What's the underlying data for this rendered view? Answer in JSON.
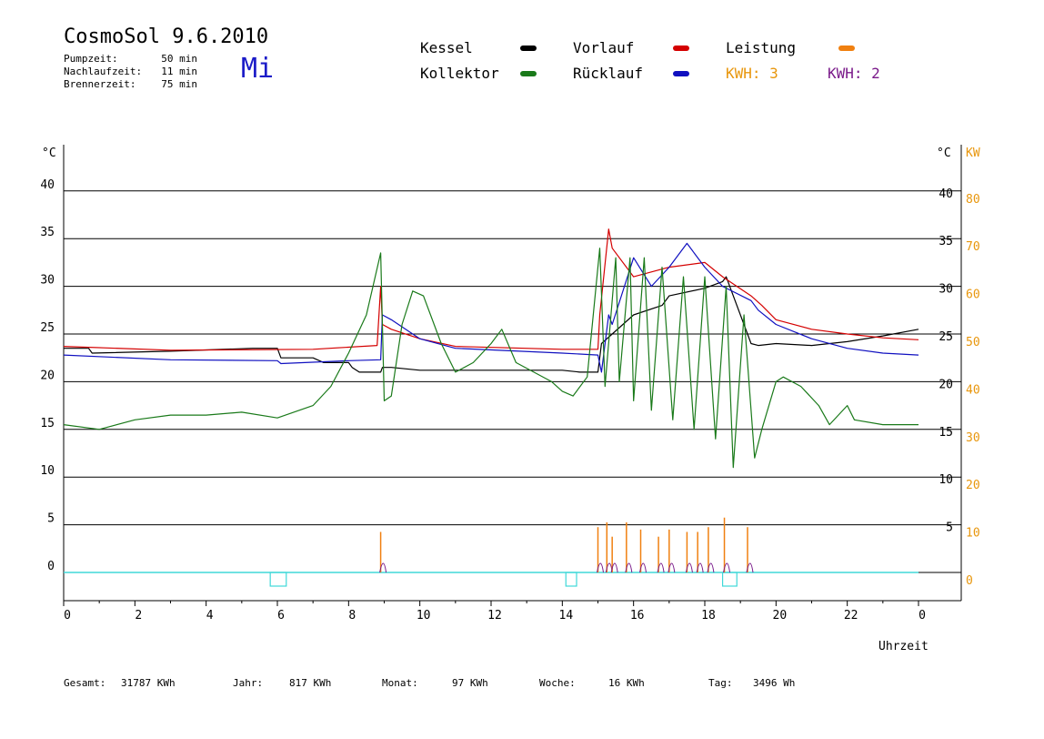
{
  "header": {
    "title": "CosmoSol 9.6.2010",
    "day": "Mi",
    "stats": [
      {
        "label": "Pumpzeit:",
        "value": "50 min"
      },
      {
        "label": "Nachlaufzeit:",
        "value": "11 min"
      },
      {
        "label": "Brennerzeit:",
        "value": "75 min"
      }
    ]
  },
  "legend": {
    "kessel": "Kessel",
    "vorlauf": "Vorlauf",
    "leistung": "Leistung",
    "kollektor": "Kollektor",
    "ruecklauf": "Rücklauf",
    "kwh1": "KWH: 3",
    "kwh2": "KWH: 2"
  },
  "footer": [
    {
      "label": "Gesamt:",
      "value": "31787 KWh"
    },
    {
      "label": "Jahr:",
      "value": "817 KWh"
    },
    {
      "label": "Monat:",
      "value": "97 KWh"
    },
    {
      "label": "Woche:",
      "value": "16 KWh"
    },
    {
      "label": "Tag:",
      "value": "3496 Wh"
    }
  ],
  "colors": {
    "kessel": "#000000",
    "vorlauf": "#d40000",
    "leistung": "#f08010",
    "kollektor": "#1a7a1a",
    "ruecklauf": "#1010c0",
    "kwh2": "#7a1a8a",
    "pump": "#40d8d8",
    "axis_kw": "#e8960c"
  },
  "chart_data": {
    "type": "line",
    "xlabel": "Uhrzeit",
    "x_ticks": [
      "0",
      "2",
      "4",
      "6",
      "8",
      "10",
      "12",
      "14",
      "16",
      "18",
      "20",
      "22",
      "0"
    ],
    "xlim": [
      0,
      24
    ],
    "y_left_label": "°C",
    "y_left_ticks": [
      "0",
      "5",
      "10",
      "15",
      "20",
      "25",
      "30",
      "35",
      "40"
    ],
    "y_right_label": "°C",
    "y_right_ticks": [
      "5",
      "10",
      "15",
      "20",
      "25",
      "30",
      "35",
      "40"
    ],
    "y_kw_label": "KW",
    "y_kw_ticks": [
      "0",
      "10",
      "20",
      "30",
      "40",
      "50",
      "60",
      "70",
      "80"
    ],
    "ylim": [
      0,
      40
    ],
    "grid": true,
    "series": [
      {
        "name": "Kessel",
        "color": "#000000",
        "x": [
          0,
          0.7,
          0.8,
          3,
          5.3,
          6,
          6.1,
          7,
          7.3,
          8,
          8.1,
          8.3,
          8.9,
          8.95,
          9.2,
          10,
          11.5,
          14,
          14.5,
          15,
          15.1,
          15.4,
          16,
          16.8,
          17,
          18,
          18.5,
          18.6,
          19.3,
          19.5,
          20,
          21,
          22,
          23,
          24
        ],
        "y": [
          23.5,
          23.5,
          23.0,
          23.2,
          23.5,
          23.5,
          22.5,
          22.5,
          22.0,
          22.0,
          21.5,
          21.0,
          21.0,
          21.5,
          21.5,
          21.2,
          21.2,
          21.2,
          21.0,
          21.0,
          24,
          25,
          27,
          28,
          29,
          29.8,
          30.5,
          31,
          24,
          23.8,
          24,
          23.8,
          24.2,
          24.8,
          25.5
        ]
      },
      {
        "name": "Vorlauf",
        "color": "#d40000",
        "x": [
          0,
          3,
          7,
          8.8,
          8.9,
          8.95,
          9.2,
          10,
          11,
          14,
          15,
          15.05,
          15.3,
          15.4,
          16,
          17,
          18,
          18.5,
          19.3,
          19.6,
          20,
          21,
          22,
          23,
          24
        ],
        "y": [
          23.7,
          23.3,
          23.4,
          23.8,
          30,
          26,
          25.5,
          24.5,
          23.7,
          23.4,
          23.4,
          27,
          36,
          34,
          31,
          32,
          32.5,
          31,
          29,
          28,
          26.5,
          25.5,
          25.0,
          24.6,
          24.4
        ]
      },
      {
        "name": "Rücklauf",
        "color": "#1010c0",
        "x": [
          0,
          3,
          6,
          6.1,
          8,
          8.9,
          8.95,
          9.2,
          10,
          11,
          14,
          15,
          15.1,
          15.3,
          15.4,
          16,
          16.5,
          17,
          17.5,
          18,
          18.5,
          19.3,
          19.5,
          20,
          21,
          22,
          23,
          24
        ],
        "y": [
          22.8,
          22.3,
          22.2,
          21.9,
          22.2,
          22.3,
          27,
          26.5,
          24.5,
          23.5,
          23.0,
          22.8,
          21,
          27,
          26,
          33,
          30,
          32,
          34.5,
          32,
          30,
          28.5,
          27.5,
          26,
          24.5,
          23.5,
          23.0,
          22.8
        ]
      },
      {
        "name": "Kollektor",
        "color": "#1a7a1a",
        "x": [
          0,
          1,
          2,
          3,
          4,
          5,
          6,
          7,
          7.5,
          8,
          8.5,
          8.9,
          9.0,
          9.2,
          9.5,
          9.8,
          10.1,
          10.6,
          11,
          11.5,
          12,
          12.3,
          12.7,
          13.2,
          13.7,
          14,
          14.3,
          14.7,
          15.05,
          15.2,
          15.5,
          15.6,
          15.9,
          16.0,
          16.3,
          16.5,
          16.8,
          17.1,
          17.4,
          17.7,
          18.0,
          18.3,
          18.6,
          18.8,
          19.1,
          19.4,
          19.6,
          20,
          20.2,
          20.7,
          21.2,
          21.5,
          22,
          22.2,
          23,
          24
        ],
        "y": [
          15.5,
          15.0,
          16.0,
          16.5,
          16.5,
          16.8,
          16.2,
          17.5,
          19.5,
          23.0,
          27.0,
          33.5,
          18.0,
          18.5,
          26.0,
          29.5,
          29.0,
          24.0,
          21.0,
          22.0,
          24.0,
          25.5,
          22.0,
          21.0,
          20.0,
          19.0,
          18.5,
          20.5,
          34.0,
          19.5,
          33.0,
          20.0,
          33.0,
          18.0,
          33.0,
          17.0,
          32.0,
          16.0,
          31.0,
          15.0,
          31.0,
          14.0,
          30.0,
          11.0,
          27.0,
          12.0,
          15.0,
          20.0,
          20.5,
          19.5,
          17.5,
          15.5,
          17.5,
          16.0,
          15.5,
          15.5
        ]
      }
    ],
    "leistung_spikes_x": [
      8.9,
      15.0,
      15.25,
      15.4,
      15.8,
      16.2,
      16.7,
      17.0,
      17.5,
      17.8,
      18.1,
      18.55,
      19.2
    ],
    "leistung_spikes_kw": [
      8.5,
      9.5,
      10.5,
      7.5,
      10.5,
      9,
      7.5,
      9,
      8.5,
      8.5,
      9.5,
      11.5,
      9.5
    ],
    "pump_periods": [
      [
        5.8,
        6.25
      ],
      [
        14.1,
        14.4
      ],
      [
        18.5,
        18.9
      ]
    ]
  }
}
